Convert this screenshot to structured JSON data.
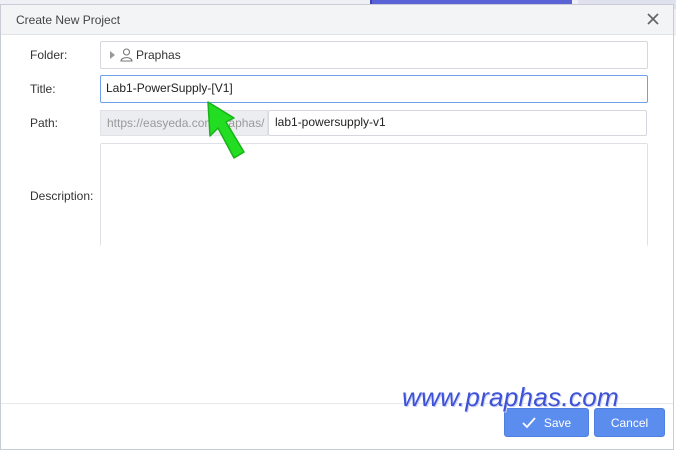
{
  "dialog": {
    "title": "Create New Project",
    "close_icon": "close-icon"
  },
  "form": {
    "folder": {
      "label": "Folder:",
      "value": "Praphas",
      "icon": "user-icon"
    },
    "title": {
      "label": "Title:",
      "value": "Lab1-PowerSupply-[V1]"
    },
    "path": {
      "label": "Path:",
      "prefix": "https://easyeda.com/praphas/",
      "value": "lab1-powersupply-v1"
    },
    "description": {
      "label": "Description:",
      "value": ""
    }
  },
  "buttons": {
    "save_label": "Save",
    "save_icon": "check-icon",
    "cancel_label": "Cancel"
  },
  "watermark": "www.praphas.com",
  "colors": {
    "accent": "#5b8def",
    "focus_border": "#6fa0e8",
    "arrow": "#22dd22",
    "watermark": "#3d52d6"
  }
}
